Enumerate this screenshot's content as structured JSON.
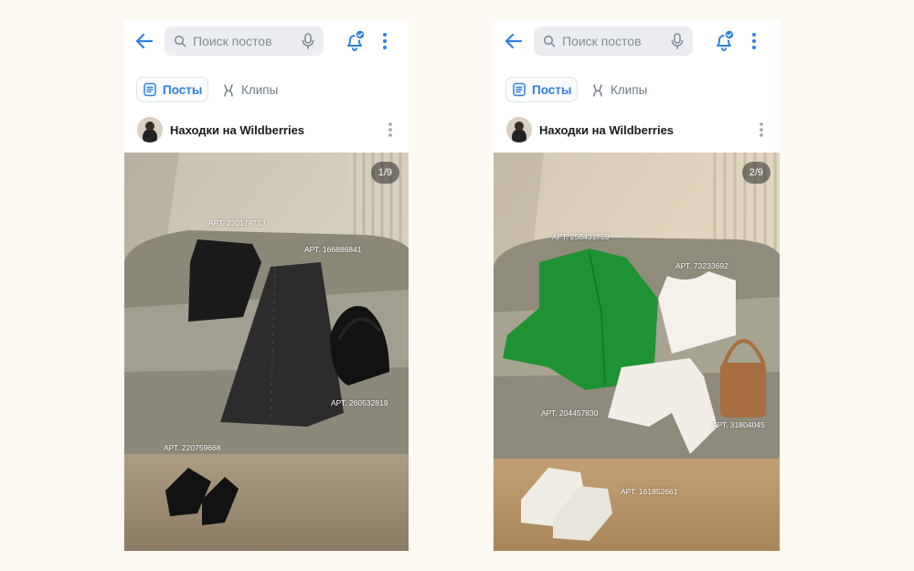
{
  "colors": {
    "background": "#fcfaf2",
    "accent": "#2d81e0",
    "search_bg": "#ebedf0",
    "muted": "#818c99"
  },
  "icons": {
    "back": "arrow-left-icon",
    "search": "search-icon",
    "mic": "microphone-icon",
    "bell": "bell-icon",
    "more": "more-vertical-icon",
    "posts": "document-icon",
    "clips": "clips-icon"
  },
  "screens": [
    {
      "search_placeholder": "Поиск постов",
      "tabs": {
        "posts": "Посты",
        "clips": "Клипы"
      },
      "post": {
        "author": "Находки на Wildberries",
        "counter": "1/9",
        "articles": [
          "АРТ. 220179713",
          "АРТ. 166886841",
          "АРТ. 260532819",
          "АРТ. 220759668"
        ]
      }
    },
    {
      "search_placeholder": "Поиск постов",
      "tabs": {
        "posts": "Посты",
        "clips": "Клипы"
      },
      "post": {
        "author": "Находки на Wildberries",
        "counter": "2/9",
        "articles": [
          "АРТ. 258431759",
          "АРТ. 73233692",
          "АРТ. 204457830",
          "АРТ. 31804045",
          "АРТ. 161852661"
        ]
      }
    }
  ]
}
